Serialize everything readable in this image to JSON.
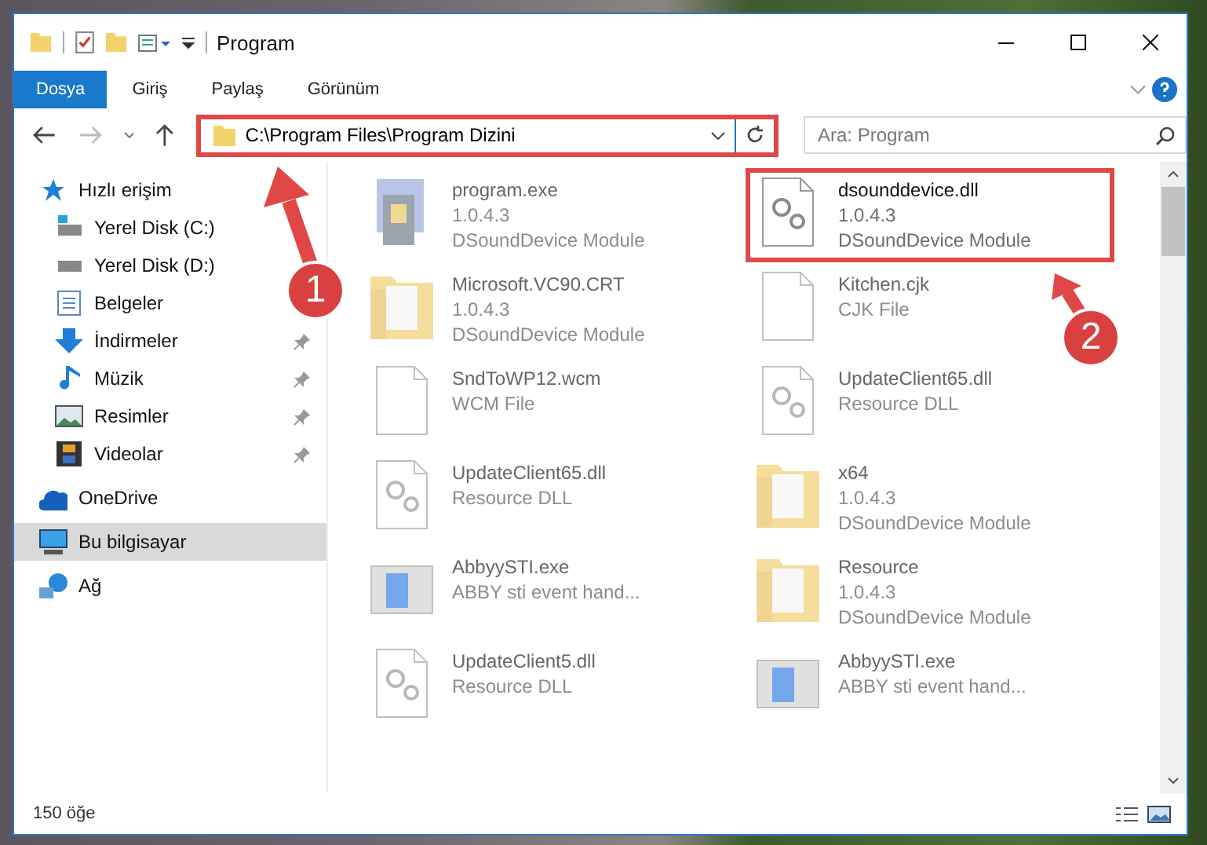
{
  "window": {
    "title": "Program"
  },
  "ribbon_tabs": [
    {
      "label": "Dosya",
      "selected": true
    },
    {
      "label": "Giriş",
      "selected": false
    },
    {
      "label": "Paylaş",
      "selected": false
    },
    {
      "label": "Görünüm",
      "selected": false
    }
  ],
  "address": {
    "value": "C:\\Program Files\\Program Dizini",
    "highlighted": true
  },
  "search": {
    "placeholder": "Ara: Program"
  },
  "sidebar": {
    "items": [
      {
        "label": "Hızlı erişim",
        "kind": "star",
        "group": true,
        "pinned": false,
        "selected": false
      },
      {
        "label": "Yerel Disk (C:)",
        "kind": "drive-c",
        "group": false,
        "pinned": false,
        "selected": false
      },
      {
        "label": "Yerel Disk (D:)",
        "kind": "drive",
        "group": false,
        "pinned": false,
        "selected": false
      },
      {
        "label": "Belgeler",
        "kind": "docs",
        "group": false,
        "pinned": false,
        "selected": false
      },
      {
        "label": "İndirmeler",
        "kind": "download",
        "group": false,
        "pinned": true,
        "selected": false
      },
      {
        "label": "Müzik",
        "kind": "music",
        "group": false,
        "pinned": true,
        "selected": false
      },
      {
        "label": "Resimler",
        "kind": "pictures",
        "group": false,
        "pinned": true,
        "selected": false
      },
      {
        "label": "Videolar",
        "kind": "videos",
        "group": false,
        "pinned": true,
        "selected": false
      },
      {
        "label": "OneDrive",
        "kind": "cloud",
        "group": true,
        "pinned": false,
        "selected": false
      },
      {
        "label": "Bu bilgisayar",
        "kind": "pc",
        "group": true,
        "pinned": false,
        "selected": true
      },
      {
        "label": "Ağ",
        "kind": "network",
        "group": true,
        "pinned": false,
        "selected": false
      }
    ]
  },
  "files": [
    {
      "name": "program.exe",
      "lines": [
        "1.0.4.3",
        "DSoundDevice Module"
      ],
      "kind": "exe",
      "highlighted": false,
      "blurred": true
    },
    {
      "name": "dsounddevice.dll",
      "lines": [
        "1.0.4.3",
        "DSoundDevice Module"
      ],
      "kind": "dll",
      "highlighted": true,
      "blurred": false
    },
    {
      "name": "Microsoft.VC90.CRT",
      "lines": [
        "1.0.4.3",
        "DSoundDevice Module"
      ],
      "kind": "folder",
      "highlighted": false,
      "blurred": true
    },
    {
      "name": "Kitchen.cjk",
      "lines": [
        "CJK File"
      ],
      "kind": "file",
      "highlighted": false,
      "blurred": true
    },
    {
      "name": "SndToWP12.wcm",
      "lines": [
        "WCM File"
      ],
      "kind": "file",
      "highlighted": false,
      "blurred": true
    },
    {
      "name": "UpdateClient65.dll",
      "lines": [
        "Resource DLL"
      ],
      "kind": "dll",
      "highlighted": false,
      "blurred": true
    },
    {
      "name": "UpdateClient65.dll",
      "lines": [
        "Resource DLL"
      ],
      "kind": "dll",
      "highlighted": false,
      "blurred": true
    },
    {
      "name": "x64",
      "lines": [
        "1.0.4.3",
        "DSoundDevice Module"
      ],
      "kind": "folder",
      "highlighted": false,
      "blurred": true
    },
    {
      "name": "AbbyySTI.exe",
      "lines": [
        "ABBY sti event hand..."
      ],
      "kind": "app",
      "highlighted": false,
      "blurred": true
    },
    {
      "name": "Resource",
      "lines": [
        "1.0.4.3",
        "DSoundDevice Module"
      ],
      "kind": "folder",
      "highlighted": false,
      "blurred": true
    },
    {
      "name": "UpdateClient5.dll",
      "lines": [
        "Resource DLL"
      ],
      "kind": "dll",
      "highlighted": false,
      "blurred": true
    },
    {
      "name": "AbbyySTI.exe",
      "lines": [
        "ABBY sti event hand..."
      ],
      "kind": "app",
      "highlighted": false,
      "blurred": true
    }
  ],
  "status_bar": {
    "count": "150 öğe"
  },
  "annotations": [
    {
      "label": "1"
    },
    {
      "label": "2"
    }
  ]
}
